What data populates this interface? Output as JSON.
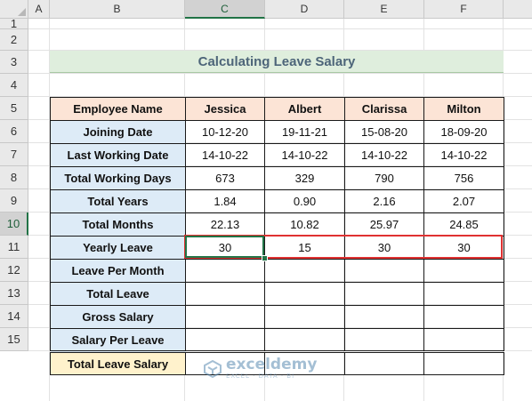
{
  "columns": [
    "A",
    "B",
    "C",
    "D",
    "E",
    "F"
  ],
  "rows": [
    "1",
    "2",
    "3",
    "4",
    "5",
    "6",
    "7",
    "8",
    "9",
    "10",
    "11",
    "12",
    "13",
    "14",
    "15"
  ],
  "title": "Calculating Leave Salary",
  "header": {
    "label": "Employee Name",
    "names": [
      "Jessica",
      "Albert",
      "Clarissa",
      "Milton"
    ]
  },
  "table": [
    {
      "label": "Joining Date",
      "values": [
        "10-12-20",
        "19-11-21",
        "15-08-20",
        "18-09-20"
      ]
    },
    {
      "label": "Last Working Date",
      "values": [
        "14-10-22",
        "14-10-22",
        "14-10-22",
        "14-10-22"
      ]
    },
    {
      "label": "Total Working Days",
      "values": [
        "673",
        "329",
        "790",
        "756"
      ]
    },
    {
      "label": "Total Years",
      "values": [
        "1.84",
        "0.90",
        "2.16",
        "2.07"
      ]
    },
    {
      "label": "Total Months",
      "values": [
        "22.13",
        "10.82",
        "25.97",
        "24.85"
      ]
    },
    {
      "label": "Yearly Leave",
      "values": [
        "30",
        "15",
        "30",
        "30"
      ]
    },
    {
      "label": "Leave Per Month",
      "values": [
        "",
        "",
        "",
        ""
      ]
    },
    {
      "label": "Total Leave",
      "values": [
        "",
        "",
        "",
        ""
      ]
    },
    {
      "label": "Gross Salary",
      "values": [
        "",
        "",
        "",
        ""
      ]
    },
    {
      "label": "Salary Per Leave",
      "values": [
        "",
        "",
        "",
        ""
      ]
    }
  ],
  "total_row": {
    "label": "Total Leave Salary",
    "values": [
      "",
      "",
      "",
      ""
    ]
  },
  "watermark": {
    "name": "exceldemy",
    "sub": "EXCEL · DATA · BI"
  },
  "colors": {
    "label_fill": "#ddebf7",
    "header_fill": "#fce4d6",
    "total_fill": "#fff2cc",
    "title_fill": "#dfeedd",
    "highlight": "#e03131",
    "excel_green": "#217346"
  }
}
